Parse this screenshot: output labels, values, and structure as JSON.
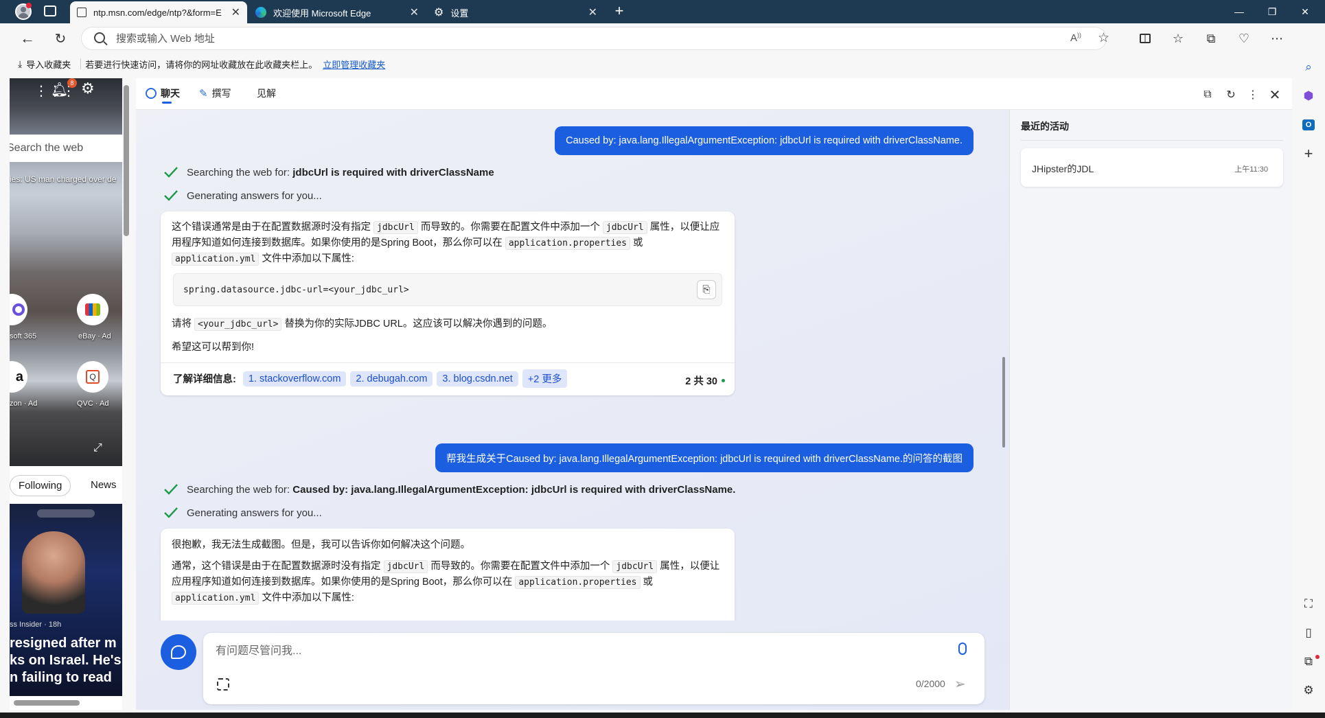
{
  "tabs": [
    {
      "title": "ntp.msn.com/edge/ntp?&form=E",
      "active": true
    },
    {
      "title": "欢迎使用 Microsoft Edge",
      "active": false
    },
    {
      "title": "设置",
      "active": false
    }
  ],
  "address": {
    "placeholder": "搜索或输入 Web 地址"
  },
  "favbar": {
    "import_label": "导入收藏夹",
    "hint": "若要进行快速访问，请将你的网址收藏放在此收藏夹栏上。",
    "manage_link": "立即管理收藏夹"
  },
  "leftpage": {
    "notif_count": "8",
    "search_placeholder": "Search the web",
    "headline": "ies: US man charged over de",
    "apps": [
      {
        "label": "soft 365"
      },
      {
        "label": "eBay · Ad"
      },
      {
        "label": "zon · Ad"
      },
      {
        "label": "QVC · Ad"
      }
    ],
    "tabs": [
      "Following",
      "News"
    ],
    "news_source": "ss Insider · 18h",
    "news_title_lines": [
      "resigned after m",
      "ks on Israel. He's",
      "n failing to read"
    ]
  },
  "copilot": {
    "tabs": [
      "聊天",
      "撰写",
      "见解"
    ],
    "messages": {
      "user1": "Caused by: java.lang.IllegalArgumentException: jdbcUrl is required with driverClassName.",
      "step1_prefix": "Searching the web for: ",
      "step1_query": "jdbcUrl is required with driverClassName",
      "step_generating": "Generating answers for you...",
      "answer1": {
        "p1_a": "这个错误通常是由于在配置数据源时没有指定",
        "p1_code1": "jdbcUrl",
        "p1_b": "而导致的。你需要在配置文件中添加一个",
        "p1_code2": "jdbcUrl",
        "p1_c": "属性，以便让应用程序知道如何连接到数据库。如果你使用的是Spring Boot，那么你可以在",
        "p1_code3": "application.properties",
        "p1_d": "或",
        "p1_code4": "application.yml",
        "p1_e": "文件中添加以下属性:",
        "code": "spring.datasource.jdbc-url=<your_jdbc_url>",
        "p2_a": "请将",
        "p2_code": "<your_jdbc_url>",
        "p2_b": "替换为你的实际JDBC URL。这应该可以解决你遇到的问题。",
        "p3": "希望这可以帮到你!",
        "learn_more": "了解详细信息:",
        "citations": [
          "1. stackoverflow.com",
          "2. debugah.com",
          "3. blog.csdn.net",
          "+2 更多"
        ],
        "count": "2 共 30"
      },
      "user2": "帮我生成关于Caused by: java.lang.IllegalArgumentException: jdbcUrl is required with driverClassName.的问答的截图",
      "step2_query": "Caused by: java.lang.IllegalArgumentException: jdbcUrl is required with driverClassName.",
      "answer2": {
        "p1": "很抱歉，我无法生成截图。但是，我可以告诉你如何解决这个问题。",
        "p2_a": "通常，这个错误是由于在配置数据源时没有指定",
        "p2_code1": "jdbcUrl",
        "p2_b": "而导致的。你需要在配置文件中添加一个",
        "p2_code2": "jdbcUrl",
        "p2_c": "属性，以便让应用程序知道如何连接到数据库。如果你使用的是Spring Boot，那么你可以在",
        "p2_code3": "application.properties",
        "p2_d": "或",
        "p2_code4": "application.yml",
        "p2_e": "文件中添加以下属性:"
      }
    },
    "input": {
      "placeholder": "有问题尽管问我...",
      "counter": "0/2000"
    },
    "recent": {
      "title": "最近的活动",
      "items": [
        {
          "title": "JHipster的JDL",
          "time": "上午11:30"
        }
      ]
    }
  },
  "colors": {
    "accent": "#1b5fe0",
    "tabstrip": "#1e3a52",
    "check": "#1a9a4a"
  }
}
